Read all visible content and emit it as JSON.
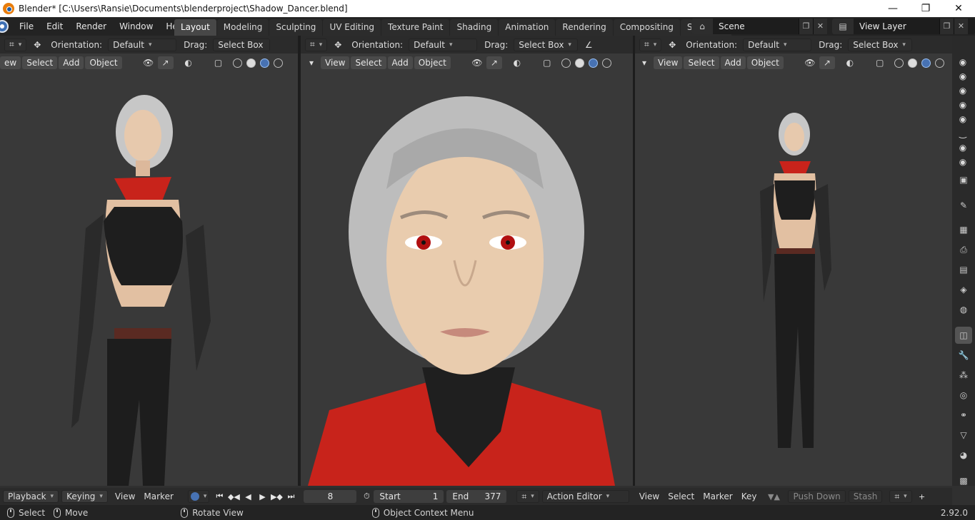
{
  "window": {
    "title": "Blender* [C:\\Users\\Ransie\\Documents\\blenderproject\\Shadow_Dancer.blend]",
    "minimize": "—",
    "maximize": "❐",
    "close": "✕"
  },
  "menu": [
    "File",
    "Edit",
    "Render",
    "Window",
    "Help"
  ],
  "workspaces": [
    "Layout",
    "Modeling",
    "Sculpting",
    "UV Editing",
    "Texture Paint",
    "Shading",
    "Animation",
    "Rendering",
    "Compositing",
    "Scripting"
  ],
  "workspace_add": "+",
  "scene": {
    "label": "Scene",
    "view_layer": "View Layer"
  },
  "viewports": [
    {
      "orientation_label": "Orientation:",
      "orientation_value": "Default",
      "drag_label": "Drag:",
      "drag_value": "Select Box",
      "menus": [
        "ew",
        "Select",
        "Add",
        "Object"
      ]
    },
    {
      "orientation_label": "Orientation:",
      "orientation_value": "Default",
      "drag_label": "Drag:",
      "drag_value": "Select Box",
      "menus": [
        "View",
        "Select",
        "Add",
        "Object"
      ]
    },
    {
      "orientation_label": "Orientation:",
      "orientation_value": "Default",
      "drag_label": "Drag:",
      "drag_value": "Select Box",
      "menus": [
        "View",
        "Select",
        "Add",
        "Object"
      ]
    }
  ],
  "timeline": {
    "playback": "Playback",
    "keying": "Keying",
    "view": "View",
    "marker": "Marker",
    "current_frame": "8",
    "start_label": "Start",
    "start_value": "1",
    "end_label": "End",
    "end_value": "377",
    "editor": "Action Editor",
    "view2": "View",
    "select": "Select",
    "marker2": "Marker",
    "key": "Key",
    "push_down": "Push Down",
    "stash": "Stash"
  },
  "status": {
    "select": "Select",
    "move": "Move",
    "rotate": "Rotate View",
    "context": "Object Context Menu",
    "version": "2.92.0"
  },
  "colors": {
    "accent": "#4772b3",
    "header_bg": "#2b2b2b",
    "viewport_bg": "#393939",
    "scarf_red": "#c8231b"
  }
}
